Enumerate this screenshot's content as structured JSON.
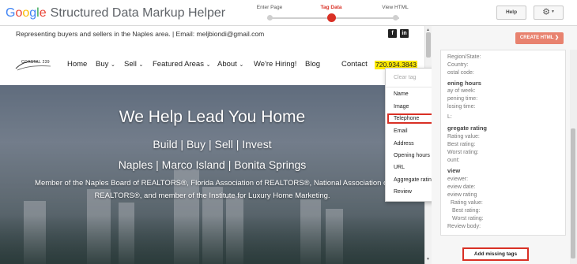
{
  "app": {
    "brand_google": [
      "G",
      "o",
      "o",
      "g",
      "l",
      "e"
    ],
    "title": "Structured Data Markup Helper",
    "steps": [
      {
        "label": "Enter Page"
      },
      {
        "label": "Tag Data",
        "active": true
      },
      {
        "label": "View HTML"
      }
    ],
    "help_label": "Help",
    "settings_icon": "gear-icon",
    "accent_color": "#d93025"
  },
  "website": {
    "topline": "Representing buyers and sellers in the Naples area. | Email: meljbiondi@gmail.com",
    "social": {
      "facebook": "f",
      "linkedin": "in"
    },
    "logo_text": "COASTAL 239",
    "nav": [
      {
        "label": "Home",
        "chevron": ""
      },
      {
        "label": "Buy",
        "chevron": "⌄"
      },
      {
        "label": "Sell",
        "chevron": "⌄"
      },
      {
        "label": "Featured Areas",
        "chevron": "⌄"
      },
      {
        "label": "About",
        "chevron": "⌄"
      },
      {
        "label": "We're Hiring!",
        "chevron": ""
      },
      {
        "label": "Blog",
        "chevron": ""
      },
      {
        "label": "Contact",
        "chevron": ""
      }
    ],
    "phone": "720.934.3843",
    "hero": {
      "heading": "We Help Lead You Home",
      "line2": "Build | Buy | Sell | Invest",
      "line3": "Naples | Marco Island | Bonita Springs",
      "line4": "Member of the Naples Board of REALTORS®, Florida Association of REALTORS®, National Association of",
      "line5": "REALTORS®, and member of the Institute for Luxury Home Marketing."
    }
  },
  "context_menu": {
    "clear": "Clear tag",
    "items": [
      {
        "label": "Name",
        "submenu": false,
        "selected": false
      },
      {
        "label": "Image",
        "submenu": false,
        "selected": false
      },
      {
        "label": "Telephone",
        "submenu": false,
        "selected": true
      },
      {
        "label": "Email",
        "submenu": false,
        "selected": false
      },
      {
        "label": "Address",
        "submenu": true,
        "selected": false
      },
      {
        "label": "Opening hours",
        "submenu": true,
        "selected": false
      },
      {
        "label": "URL",
        "submenu": false,
        "selected": false
      },
      {
        "label": "Aggregate rating",
        "submenu": true,
        "selected": false
      },
      {
        "label": "Review",
        "submenu": true,
        "selected": false
      }
    ],
    "submenu_arrow": "▸"
  },
  "right_panel": {
    "create_html_label": "CREATE HTML",
    "create_html_arrow": "❯",
    "lines": [
      {
        "text": "Region/State:",
        "kind": "field"
      },
      {
        "text": "Country:",
        "kind": "field"
      },
      {
        "text": "ostal code:",
        "kind": "field"
      },
      {
        "text": "ening hours",
        "kind": "head"
      },
      {
        "text": "ay of week:",
        "kind": "field"
      },
      {
        "text": "pening time:",
        "kind": "field"
      },
      {
        "text": "losing time:",
        "kind": "field"
      },
      {
        "text": "L:",
        "kind": "field"
      },
      {
        "text": "gregate rating",
        "kind": "head"
      },
      {
        "text": "Rating value:",
        "kind": "field"
      },
      {
        "text": "Best rating:",
        "kind": "field"
      },
      {
        "text": "Worst rating:",
        "kind": "field"
      },
      {
        "text": "ount:",
        "kind": "field"
      },
      {
        "text": "view",
        "kind": "head"
      },
      {
        "text": "eviewer:",
        "kind": "field"
      },
      {
        "text": "eview date:",
        "kind": "field"
      },
      {
        "text": "eview rating",
        "kind": "field"
      },
      {
        "text": "Rating value:",
        "kind": "field"
      },
      {
        "text": "Best rating:",
        "kind": "field"
      },
      {
        "text": "Worst rating:",
        "kind": "field"
      },
      {
        "text": "Review body:",
        "kind": "field"
      }
    ],
    "add_missing_tags_label": "Add missing tags"
  }
}
